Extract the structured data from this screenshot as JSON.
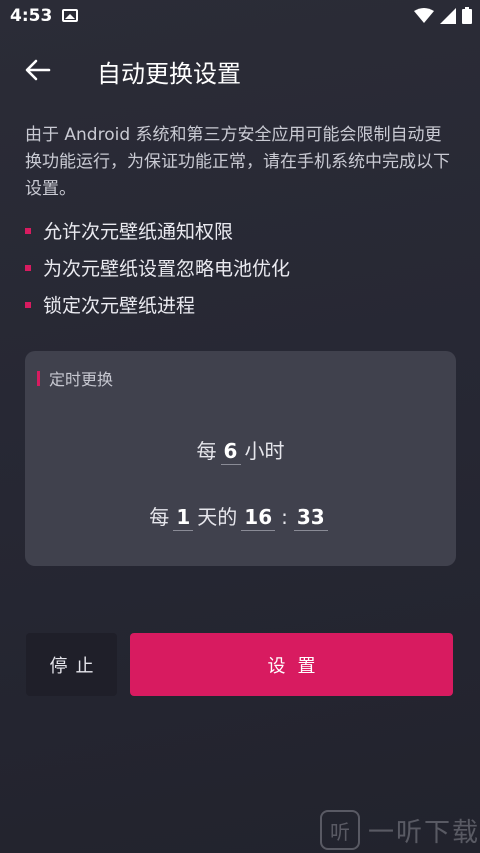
{
  "status_bar": {
    "time": "4:53",
    "icons": [
      "image-icon",
      "wifi-icon",
      "signal-icon",
      "battery-icon"
    ]
  },
  "app_bar": {
    "back_icon": "arrow-left-icon",
    "title": "自动更换设置"
  },
  "intro": "由于 Android 系统和第三方安全应用可能会限制自动更换功能运行，为保证功能正常，请在手机系统中完成以下设置。",
  "bullets": [
    "允许次元壁纸通知权限",
    "为次元壁纸设置忽略电池优化",
    "锁定次元壁纸进程"
  ],
  "schedule_card": {
    "label": "定时更换",
    "row1": {
      "prefix": "每",
      "hours": "6",
      "suffix": "小时"
    },
    "row2": {
      "prefix": "每",
      "days": "1",
      "middle": "天的",
      "hour": "16",
      "colon": ":",
      "minute": "33"
    }
  },
  "buttons": {
    "stop": "停止",
    "set": "设置"
  },
  "watermark": {
    "icon_glyph": "听",
    "text": "一听下载"
  },
  "colors": {
    "accent": "#d81b60",
    "background": "#2b2c37",
    "card": "#40414d",
    "stop_button": "#1f1f29"
  }
}
